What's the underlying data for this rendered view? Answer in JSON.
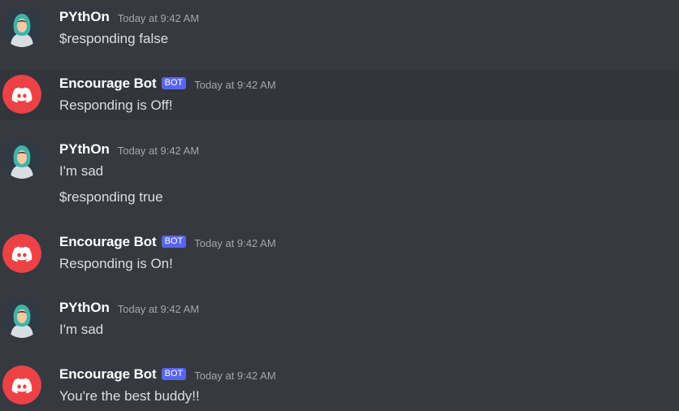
{
  "colors": {
    "background": "#36393f",
    "highlight_row": "#32353b",
    "username": "#ffffff",
    "message_text": "#dcddde",
    "timestamp": "#a3a6aa",
    "bot_tag": "#5865f2",
    "bot_avatar": "#ed4245",
    "user_avatar_bg": "#2f3a44"
  },
  "messages": [
    {
      "author": "PYthOn",
      "avatar_icon": "hooded-figure-icon",
      "timestamp": "Today at 9:42 AM",
      "lines": [
        "$responding false"
      ]
    },
    {
      "author": "Encourage Bot",
      "avatar_icon": "discord-logo-icon",
      "bot_tag": "BOT",
      "timestamp": "Today at 9:42 AM",
      "lines": [
        "Responding is Off!"
      ]
    },
    {
      "author": "PYthOn",
      "avatar_icon": "hooded-figure-icon",
      "timestamp": "Today at 9:42 AM",
      "lines": [
        "I'm sad",
        "$responding true"
      ]
    },
    {
      "author": "Encourage Bot",
      "avatar_icon": "discord-logo-icon",
      "bot_tag": "BOT",
      "timestamp": "Today at 9:42 AM",
      "lines": [
        "Responding is On!"
      ]
    },
    {
      "author": "PYthOn",
      "avatar_icon": "hooded-figure-icon",
      "timestamp": "Today at 9:42 AM",
      "lines": [
        "I'm sad"
      ]
    },
    {
      "author": "Encourage Bot",
      "avatar_icon": "discord-logo-icon",
      "bot_tag": "BOT",
      "timestamp": "Today at 9:42 AM",
      "lines": [
        "You're the best buddy!!"
      ]
    }
  ]
}
